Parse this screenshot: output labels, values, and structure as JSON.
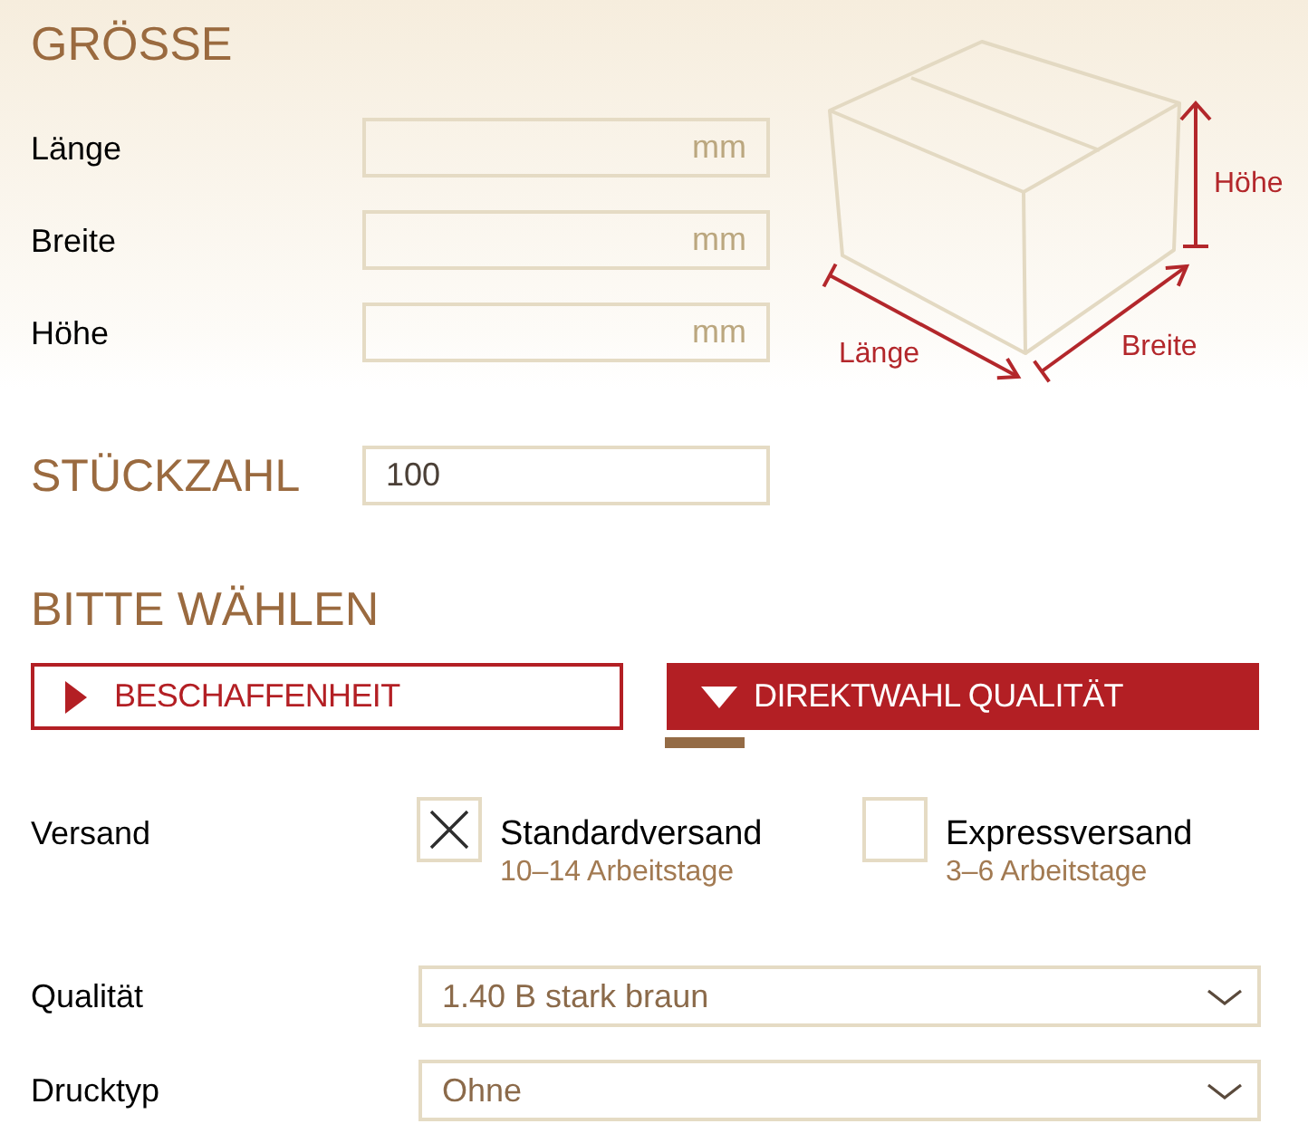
{
  "size": {
    "title": "GRÖSSE",
    "fields": [
      {
        "label": "Länge",
        "placeholder": "mm"
      },
      {
        "label": "Breite",
        "placeholder": "mm"
      },
      {
        "label": "Höhe",
        "placeholder": "mm"
      }
    ]
  },
  "box_diagram": {
    "length_label": "Länge",
    "width_label": "Breite",
    "height_label": "Höhe"
  },
  "quantity": {
    "label": "STÜCKZAHL",
    "value": "100"
  },
  "choice": {
    "title": "BITTE WÄHLEN",
    "tabs": [
      {
        "label": "BESCHAFFENHEIT",
        "selected": false
      },
      {
        "label": "DIREKTWAHL QUALITÄT",
        "selected": true
      }
    ]
  },
  "shipping": {
    "label": "Versand",
    "options": [
      {
        "name": "Standardversand",
        "detail": "10–14 Arbeitstage",
        "checked": true
      },
      {
        "name": "Expressversand",
        "detail": "3–6 Arbeitstage",
        "checked": false
      }
    ]
  },
  "selects": [
    {
      "label": "Qualität",
      "value": "1.40 B stark braun"
    },
    {
      "label": "Drucktyp",
      "value": "Ohne"
    }
  ]
}
